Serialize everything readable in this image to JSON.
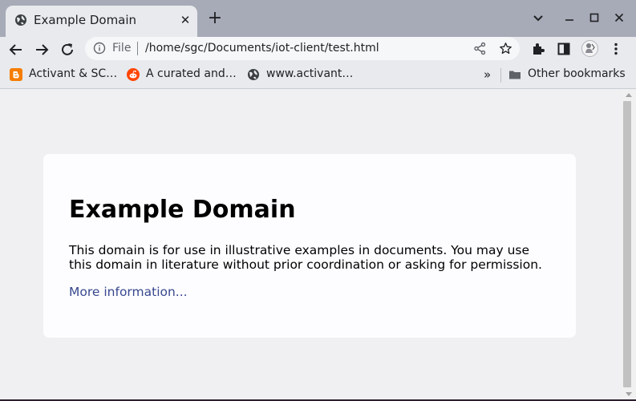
{
  "tab": {
    "title": "Example Domain",
    "favicon": "globe-icon",
    "close": "✕",
    "new_tab": "+"
  },
  "window": {
    "tabsearch": "chevron-down-icon",
    "minimize": "—",
    "maximize": "☐",
    "close": "✕"
  },
  "toolbar": {
    "scheme": "File",
    "url": "/home/sgc/Documents/iot-client/test.html"
  },
  "bookmarks": {
    "items": [
      {
        "label": "Activant & SC…",
        "icon": "blogger-icon"
      },
      {
        "label": "A curated and…",
        "icon": "reddit-icon"
      },
      {
        "label": "www.activant…",
        "icon": "globe-icon"
      }
    ],
    "overflow": "»",
    "other": "Other bookmarks"
  },
  "page": {
    "heading": "Example Domain",
    "paragraph": "This domain is for use in illustrative examples in documents. You may use this domain in literature without prior coordination or asking for permission.",
    "link": "More information..."
  },
  "colors": {
    "tabstrip": "#a7aab7",
    "toolbar": "#e8eaed",
    "page_background": "#f0f0f2",
    "card_background": "#fdfdff",
    "link": "#38488f",
    "blogger": "#f57d00",
    "reddit": "#ff4500"
  }
}
